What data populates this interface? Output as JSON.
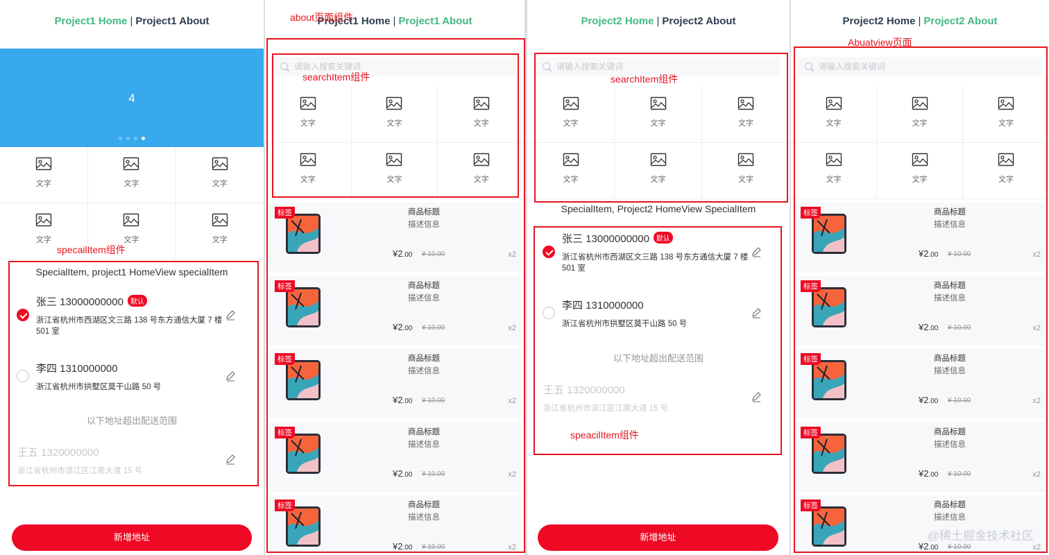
{
  "panels": {
    "p1": {
      "nav_home": "Project1 Home",
      "nav_about": "Project1 About",
      "swipe_value": "4",
      "swipe_active_index": 3
    },
    "p2": {
      "nav_home": "Project1 Home",
      "nav_about": "Project1 About"
    },
    "p3": {
      "nav_home": "Project2 Home",
      "nav_about": "Project2 About"
    },
    "p4": {
      "nav_home": "Project2 Home",
      "nav_about": "Project2 About"
    }
  },
  "nav_separator": "|",
  "search_placeholder": "请输入搜索关键词",
  "grid_label": "文字",
  "special_titles": {
    "p1": "SpecialItem, project1 HomeView specialItem",
    "p3": "SpecialItem, Project2 HomeView SpecialItem"
  },
  "addresses": [
    {
      "name": "张三 13000000000",
      "tag": "默认",
      "address": "浙江省杭州市西湖区文三路 138 号东方通信大厦 7 楼 501 室",
      "checked": true
    },
    {
      "name": "李四 1310000000",
      "address": "浙江省杭州市拱墅区莫干山路 50 号",
      "checked": false
    }
  ],
  "disabled_hint": "以下地址超出配送范围",
  "disabled_address": {
    "name": "王五 1320000000",
    "address": "浙江省杭州市滨江区江南大道 15 号"
  },
  "add_button": "新增地址",
  "goods": {
    "tag": "标签",
    "title": "商品标题",
    "desc": "描述信息",
    "price_main": "¥2",
    "price_dec": ".00",
    "origin_price": "¥ 10.00",
    "num": "x2"
  },
  "annotations": {
    "p1_special": "specailItem组件",
    "p2_about": "about页面组件",
    "p2_search": "searchItem组件",
    "p3_search": "searchItem组件",
    "p3_special": "speacilItem组件",
    "p4_view": "Abuatview页面"
  },
  "watermark": "@稀土掘金技术社区",
  "colors": {
    "brand_red": "#ee0a24",
    "vue_green": "#42b983",
    "swipe_blue": "#39a9ed",
    "annotation_red": "#e6141e"
  },
  "icons": {
    "search": "search-icon",
    "grid": "photo-icon",
    "edit": "edit-icon",
    "check": "checked-icon"
  }
}
